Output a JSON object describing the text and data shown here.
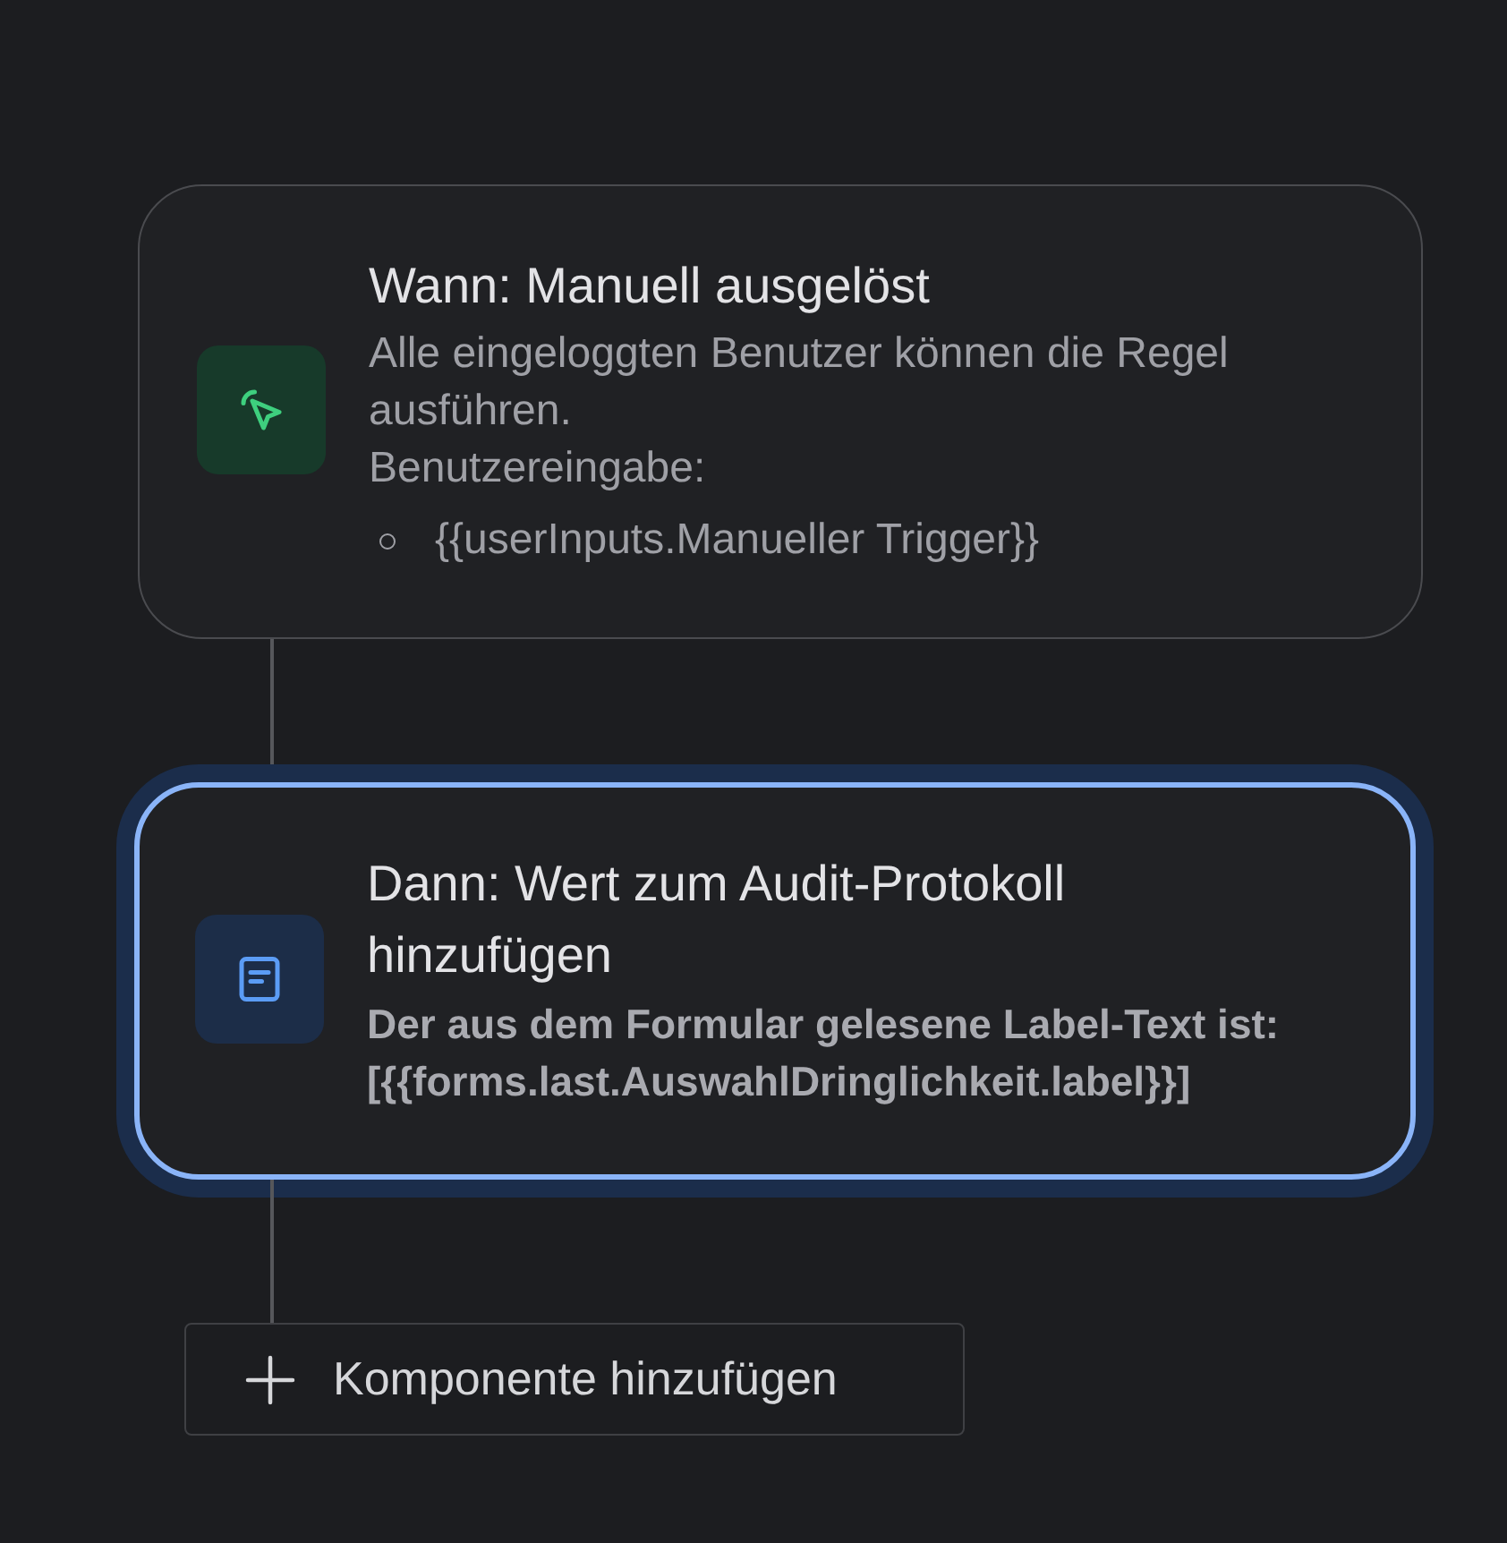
{
  "steps": [
    {
      "kind": "trigger",
      "selected": false,
      "title": "Wann: Manuell ausgelöst",
      "description": "Alle eingeloggten Benutzer können die Regel ausführen.",
      "details": [
        {
          "kind": "label",
          "text": "Benutzereingabe:"
        },
        {
          "kind": "bullet",
          "text": "{{userInputs.Manueller Trigger}}"
        }
      ]
    },
    {
      "kind": "action",
      "selected": true,
      "title": "Dann: Wert zum Audit-Protokoll hinzufügen",
      "description": "Der aus dem Formular gelesene Label-Text ist: [{{forms.last.AuswahlDringlichkeit.label}}]"
    }
  ],
  "add_button": {
    "label": "Komponente hinzufügen"
  }
}
